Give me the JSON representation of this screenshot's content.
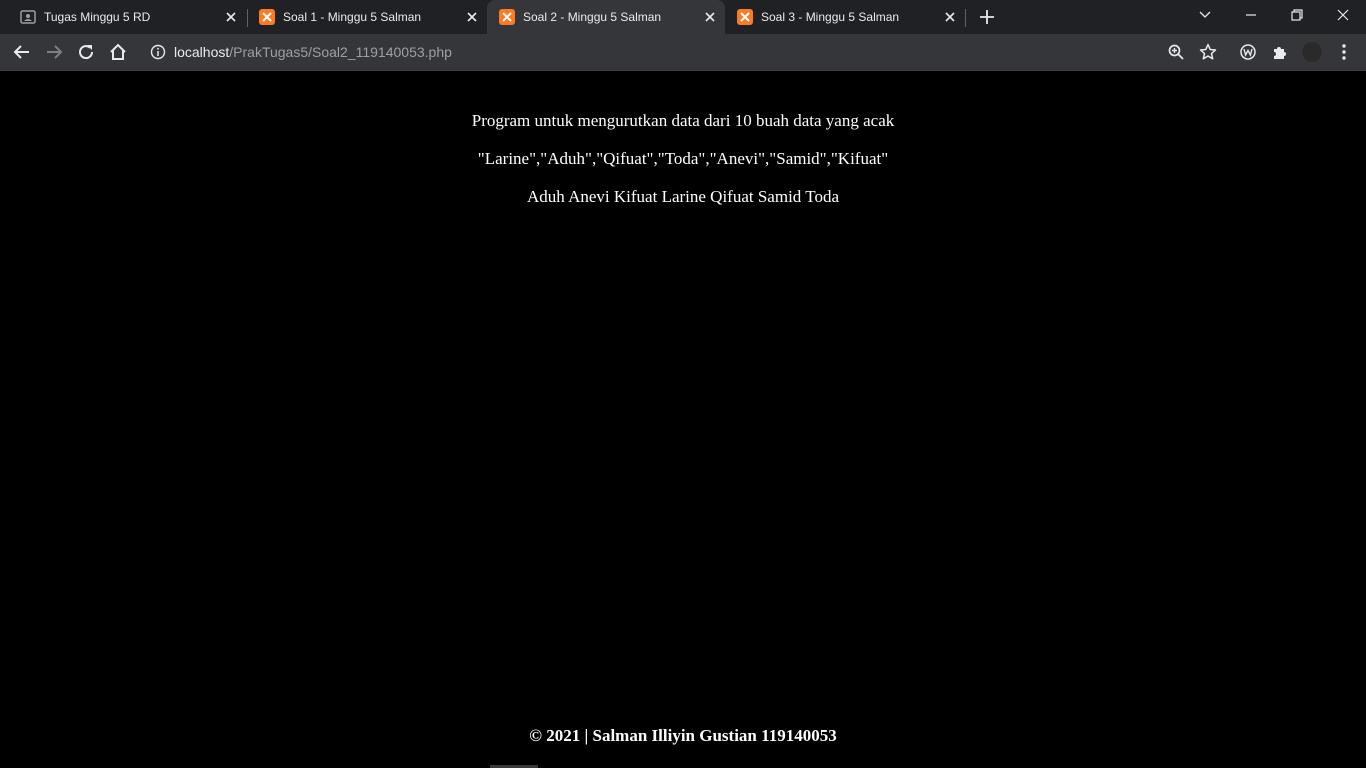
{
  "browser": {
    "tabs": [
      {
        "title": "Tugas Minggu 5 RD",
        "icon": "classroom-icon",
        "active": false
      },
      {
        "title": "Soal 1 - Minggu 5 Salman",
        "icon": "xampp-icon",
        "active": false
      },
      {
        "title": "Soal 2 - Minggu 5 Salman",
        "icon": "xampp-icon",
        "active": true
      },
      {
        "title": "Soal 3 - Minggu 5 Salman",
        "icon": "xampp-icon",
        "active": false
      }
    ],
    "address_bar": {
      "host": "localhost",
      "path": "/PrakTugas5/Soal2_119140053.php"
    },
    "colors": {
      "tabstrip_bg": "#202124",
      "toolbar_bg": "#35363a",
      "xampp_orange": "#fb7a24",
      "text": "#e8eaed"
    }
  },
  "page": {
    "heading": "Program untuk mengurutkan data dari 10 buah data yang acak",
    "input_data": "\"Larine\",\"Aduh\",\"Qifuat\",\"Toda\",\"Anevi\",\"Samid\",\"Kifuat\"",
    "sorted_output": "Aduh Anevi Kifuat Larine Qifuat Samid Toda",
    "footer": "© 2021 | Salman Illiyin Gustian 119140053",
    "background": "#000000",
    "text_color": "#ffffff"
  }
}
